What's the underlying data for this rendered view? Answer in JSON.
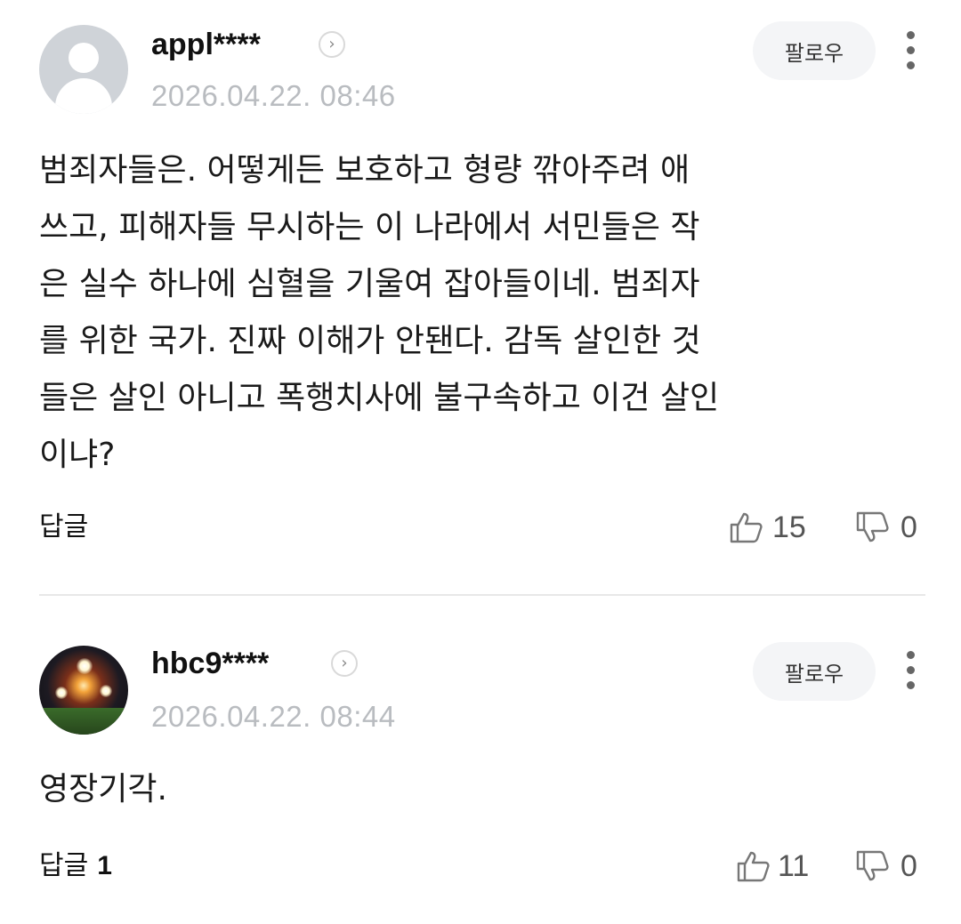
{
  "comments": [
    {
      "username": "appl****",
      "avatar_icon": "default-profile-icon",
      "date": "2026.04.22. 08:46",
      "follow_label": "팔로우",
      "body_lines": [
        "범죄자들은. 어떻게든 보호하고 형량 깎아주려 애",
        "쓰고, 피해자들 무시하는 이 나라에서 서민들은 작",
        "은 실수 하나에 심혈을 기울여 잡아들이네. 범죄자",
        "를 위한 국가. 진짜 이해가 안됀다. 감독 살인한 것",
        "들은 살인 아니고 폭행치사에 불구속하고 이건 살인",
        "이냐?"
      ],
      "reply_label": "답글",
      "reply_count": "",
      "likes": "15",
      "dislikes": "0"
    },
    {
      "username": "hbc9****",
      "avatar_icon": "photo-avatar-fireworks",
      "date": "2026.04.22. 08:44",
      "follow_label": "팔로우",
      "body_lines": [
        "영장기각."
      ],
      "reply_label": "답글",
      "reply_count": "1",
      "likes": "11",
      "dislikes": "0"
    }
  ],
  "icons": {
    "chevron": "›",
    "like": "thumbs-up-icon",
    "dislike": "thumbs-down-icon",
    "more": "more-vertical-icon"
  }
}
